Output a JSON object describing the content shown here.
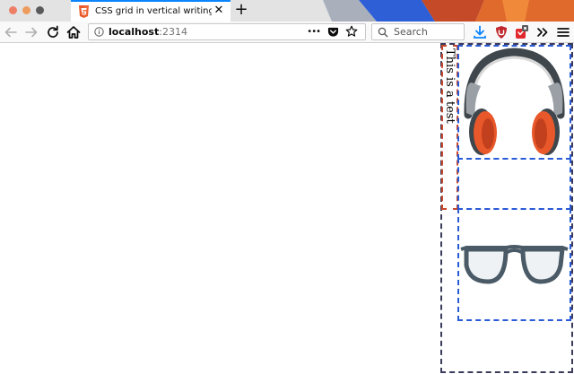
{
  "window": {
    "traffic_lights": [
      {
        "name": "close",
        "color": "#ee7f66"
      },
      {
        "name": "minimize",
        "color": "#ee9b5e"
      },
      {
        "name": "maximize",
        "color": "#5a5a5c"
      }
    ]
  },
  "tabs": [
    {
      "title": "CSS grid in vertical writing mo",
      "favicon": "html5-icon",
      "close_glyph": "✕",
      "active": true
    }
  ],
  "new_tab_glyph": "+",
  "navbar": {
    "url_host": "localhost",
    "url_port": ":2314",
    "search_placeholder": "Search",
    "page_actions_glyph": "•••"
  },
  "page": {
    "text_item": "This is a test",
    "images": [
      {
        "name": "headphones-image",
        "description_icon": "headphones"
      },
      {
        "name": "glasses-image",
        "description_icon": "glasses"
      }
    ]
  },
  "colors": {
    "accent": "#0a84ff",
    "grid_outline": "#3b3b5c",
    "text_item_outline": "#c7472c",
    "image_cell_outline": "#2a5bd7",
    "headphone_orange": "#e8582a",
    "glasses_frame": "#4a5a66"
  }
}
